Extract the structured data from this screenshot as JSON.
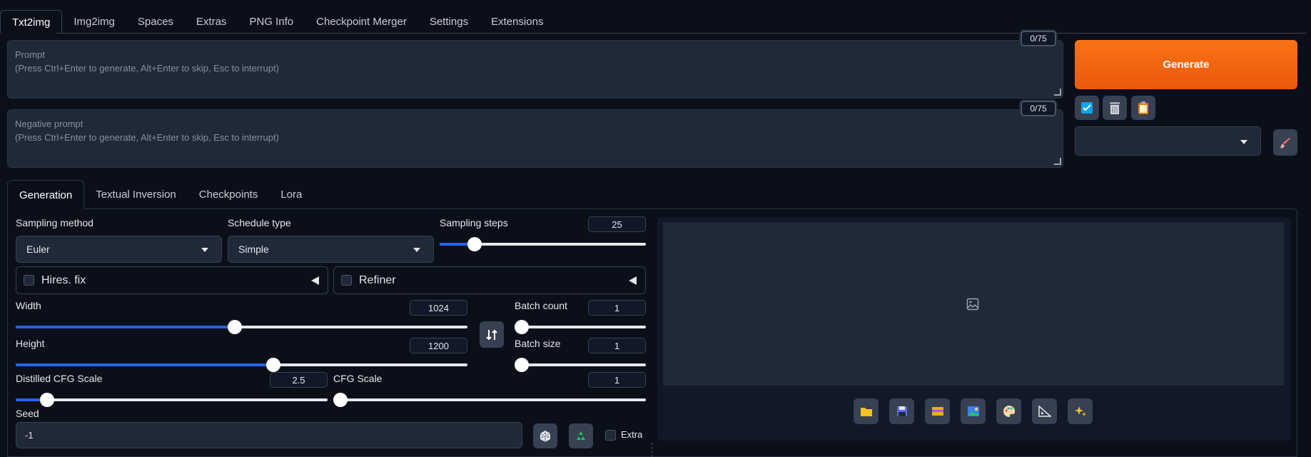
{
  "top_tabs": [
    "Txt2img",
    "Img2img",
    "Spaces",
    "Extras",
    "PNG Info",
    "Checkpoint Merger",
    "Settings",
    "Extensions"
  ],
  "prompt": {
    "label": "Prompt",
    "placeholder": "(Press Ctrl+Enter to generate, Alt+Enter to skip, Esc to interrupt)",
    "counter": "0/75"
  },
  "negative_prompt": {
    "label": "Negative prompt",
    "placeholder": "(Press Ctrl+Enter to generate, Alt+Enter to skip, Esc to interrupt)",
    "counter": "0/75"
  },
  "generate": {
    "label": "Generate"
  },
  "style_select": {
    "value": ""
  },
  "sub_tabs": [
    "Generation",
    "Textual Inversion",
    "Checkpoints",
    "Lora"
  ],
  "sampling_method": {
    "label": "Sampling method",
    "value": "Euler"
  },
  "schedule_type": {
    "label": "Schedule type",
    "value": "Simple"
  },
  "sampling_steps": {
    "label": "Sampling steps",
    "value": "25",
    "fraction": 0.17
  },
  "hires_fix": {
    "label": "Hires. fix",
    "checked": false
  },
  "refiner": {
    "label": "Refiner",
    "checked": false
  },
  "width": {
    "label": "Width",
    "value": "1024",
    "fraction": 0.485
  },
  "height": {
    "label": "Height",
    "value": "1200",
    "fraction": 0.57
  },
  "batch_count": {
    "label": "Batch count",
    "value": "1",
    "fraction": 0.0
  },
  "batch_size": {
    "label": "Batch size",
    "value": "1",
    "fraction": 0.0
  },
  "distilled_cfg": {
    "label": "Distilled CFG Scale",
    "value": "2.5",
    "fraction": 0.1
  },
  "cfg_scale": {
    "label": "CFG Scale",
    "value": "1",
    "fraction": 0.0
  },
  "seed": {
    "label": "Seed",
    "value": "-1"
  },
  "extra": {
    "label": "Extra",
    "checked": false
  },
  "colors": {
    "accent": "#2563eb",
    "generate": "#f97316",
    "background": "#0b0f19",
    "surface": "#1f2937"
  },
  "gallery_tools": [
    "folder-icon",
    "save-icon",
    "zip-icon",
    "image-icon",
    "palette-icon",
    "ruler-icon",
    "sparkles-icon"
  ]
}
